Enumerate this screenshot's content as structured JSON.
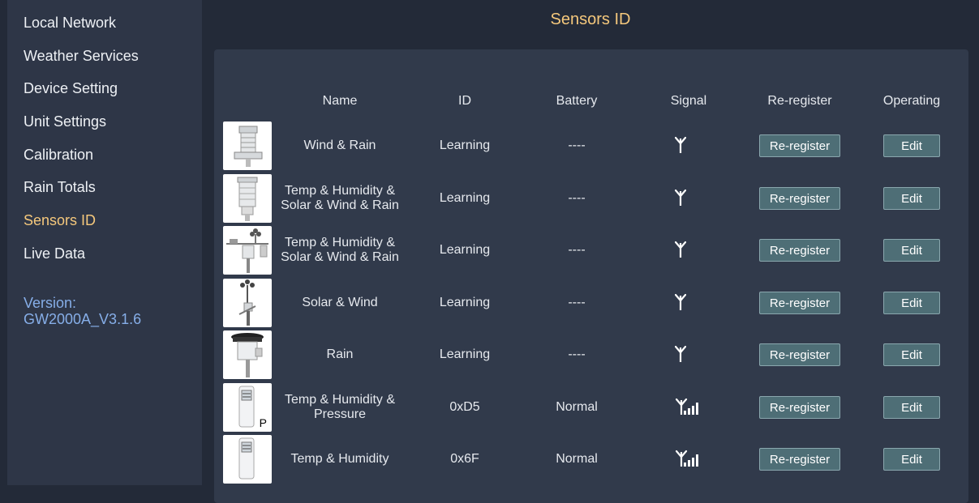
{
  "sidebar": {
    "items": [
      {
        "label": "Local Network"
      },
      {
        "label": "Weather Services"
      },
      {
        "label": "Device Setting"
      },
      {
        "label": "Unit Settings"
      },
      {
        "label": "Calibration"
      },
      {
        "label": "Rain Totals"
      },
      {
        "label": "Sensors ID",
        "active": true
      },
      {
        "label": "Live Data"
      }
    ],
    "version_label": "Version:",
    "version_value": "GW2000A_V3.1.6"
  },
  "page": {
    "title": "Sensors ID"
  },
  "table": {
    "headers": {
      "name": "Name",
      "id": "ID",
      "battery": "Battery",
      "signal": "Signal",
      "reregister": "Re-register",
      "operating": "Operating"
    },
    "rows": [
      {
        "name_line1": "Wind & Rain",
        "name_line2": "",
        "id": "Learning",
        "battery": "----",
        "signal_bars": 0,
        "reregister_label": "Re-register",
        "edit_label": "Edit",
        "image": "wind-rain-sensor-icon"
      },
      {
        "name_line1": "Temp & Humidity &",
        "name_line2": "Solar & Wind & Rain",
        "id": "Learning",
        "battery": "----",
        "signal_bars": 0,
        "reregister_label": "Re-register",
        "edit_label": "Edit",
        "image": "cylinder-sensor-icon"
      },
      {
        "name_line1": "Temp & Humidity &",
        "name_line2": "Solar & Wind & Rain",
        "id": "Learning",
        "battery": "----",
        "signal_bars": 0,
        "reregister_label": "Re-register",
        "edit_label": "Edit",
        "image": "weather-station-array-icon"
      },
      {
        "name_line1": "Solar & Wind",
        "name_line2": "",
        "id": "Learning",
        "battery": "----",
        "signal_bars": 0,
        "reregister_label": "Re-register",
        "edit_label": "Edit",
        "image": "anemometer-icon"
      },
      {
        "name_line1": "Rain",
        "name_line2": "",
        "id": "Learning",
        "battery": "----",
        "signal_bars": 0,
        "reregister_label": "Re-register",
        "edit_label": "Edit",
        "image": "rain-gauge-icon"
      },
      {
        "name_line1": "Temp & Humidity &",
        "name_line2": "Pressure",
        "id": "0xD5",
        "battery": "Normal",
        "signal_bars": 4,
        "reregister_label": "Re-register",
        "edit_label": "Edit",
        "image": "thermo-hygro-pressure-sensor-icon",
        "image_badge": "P"
      },
      {
        "name_line1": "Temp & Humidity",
        "name_line2": "",
        "id": "0x6F",
        "battery": "Normal",
        "signal_bars": 4,
        "reregister_label": "Re-register",
        "edit_label": "Edit",
        "image": "thermo-hygro-sensor-icon"
      }
    ]
  }
}
